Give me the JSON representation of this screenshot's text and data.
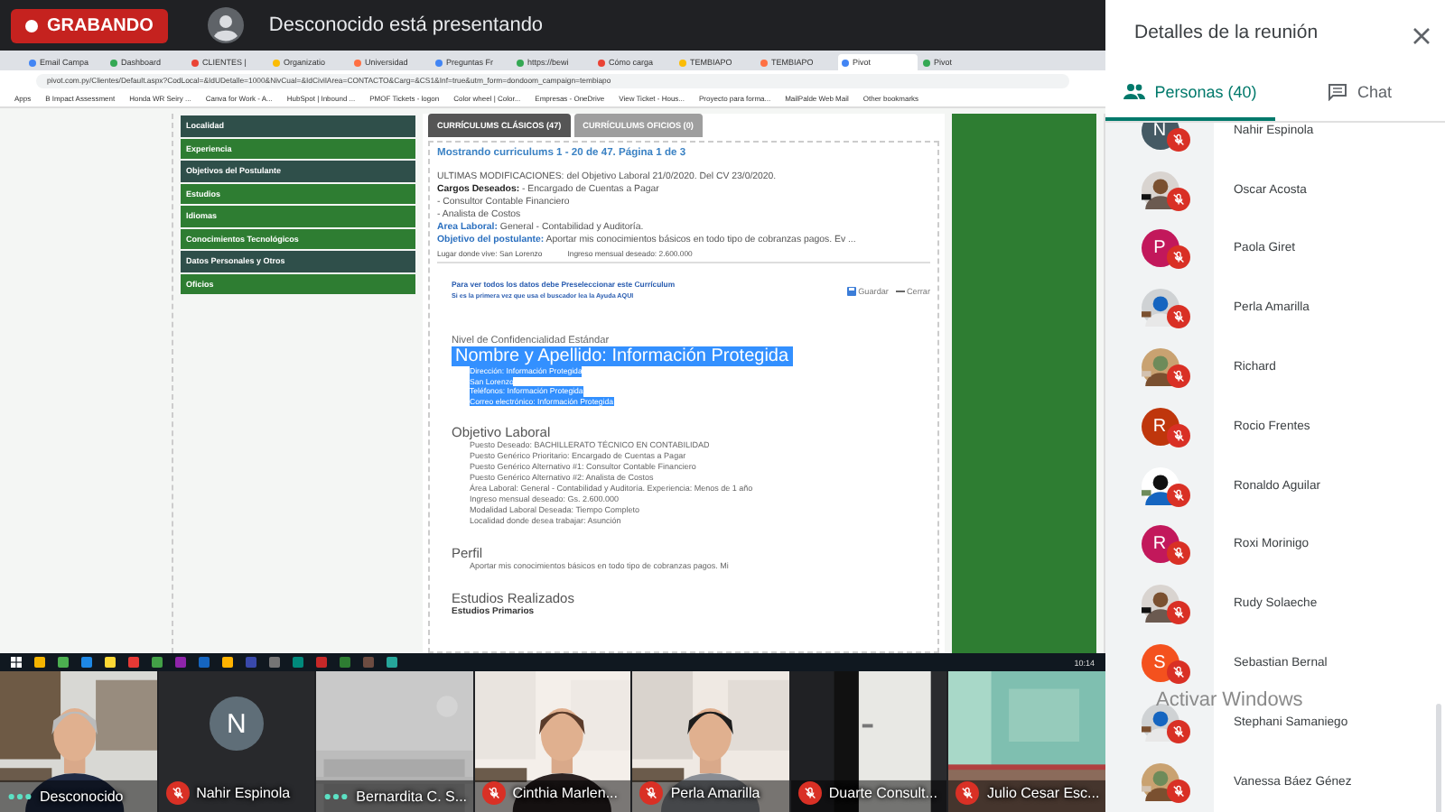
{
  "recording": {
    "label": "GRABANDO"
  },
  "presenter": {
    "text": "Desconocido está presentando"
  },
  "browser": {
    "tabs": [
      {
        "title": "Email Campa",
        "selected": false
      },
      {
        "title": "Dashboard",
        "selected": false
      },
      {
        "title": "CLIENTES |",
        "selected": false
      },
      {
        "title": "Organizatio",
        "selected": false
      },
      {
        "title": "Universidad",
        "selected": false
      },
      {
        "title": "Preguntas Fr",
        "selected": false
      },
      {
        "title": "https://bewi",
        "selected": false
      },
      {
        "title": "Cómo carga",
        "selected": false
      },
      {
        "title": "TEMBIAPO",
        "selected": false
      },
      {
        "title": "TEMBIAPO",
        "selected": false
      },
      {
        "title": "Pivot",
        "selected": true
      },
      {
        "title": "Pivot",
        "selected": false
      }
    ],
    "address": "pivot.com.py/Clientes/Default.aspx?CodLocal=&IdUDetalle=1000&NivCual=&IdCivilArea=CONTACTO&Carg=&CS1&Inf=true&utm_form=dondoom_campaign=tembiapo",
    "bookmarks": [
      "Apps",
      "B Impact Assessment",
      "Honda WR Seiry ...",
      "Canva for Work - A...",
      "HubSpot | Inbound ...",
      "PMOF Tickets - logon",
      "Color wheel | Color...",
      "Empresas - OneDrive",
      "View Ticket - Hous...",
      "Proyecto para forma...",
      "MailPalde Web Mail",
      "Other bookmarks"
    ]
  },
  "page": {
    "menu": [
      {
        "label": "Localidad",
        "color": "#2f4f4a"
      },
      {
        "label": "Experiencia",
        "color": "#2e7d32"
      },
      {
        "label": "Objetivos del Postulante",
        "color": "#2f4f4a"
      },
      {
        "label": "Estudios",
        "color": "#2e7d32"
      },
      {
        "label": "Idiomas",
        "color": "#2e7d32"
      },
      {
        "label": "Conocimientos Tecnológicos",
        "color": "#2e7d32"
      },
      {
        "label": "Datos Personales y Otros",
        "color": "#2f4f4a"
      },
      {
        "label": "Oficios",
        "color": "#2e7d32"
      }
    ],
    "tabs": [
      {
        "label": "CURRÍCULUMS CLÁSICOS (47)",
        "selected": true
      },
      {
        "label": "CURRÍCULUMS OFICIOS (0)",
        "selected": false
      }
    ],
    "heading": "Mostrando curriculums 1 - 20 de 47. Página 1 de 3",
    "summary": [
      {
        "kind": "plain",
        "label": "ULTIMAS MODIFICACIONES:",
        "value": "del Objetivo Laboral 21/0/2020. Del CV 23/0/2020."
      },
      {
        "kind": "dark",
        "label": "Cargos Deseados:",
        "value": "- Encargado de Cuentas a Pagar"
      },
      {
        "kind": "none",
        "value": "- Consultor Contable Financiero"
      },
      {
        "kind": "none",
        "value": "- Analista de Costos"
      },
      {
        "kind": "blue",
        "label": "Area Laboral:",
        "value": "General - Contabilidad y Auditoría."
      },
      {
        "kind": "blue",
        "label": "Objetivo del postulante:",
        "value": "Aportar mis conocimientos básicos en todo tipo de cobranzas pagos. Ev ..."
      }
    ],
    "summary_footer": [
      {
        "label": "Lugar donde vive:",
        "value": "San Lorenzo"
      },
      {
        "label": "Ingreso mensual deseado:",
        "value": "2.600.000"
      }
    ],
    "notice": [
      "Para ver todos los datos debe Preseleccionar este Currículum",
      "Si es la primera vez que usa el buscador lea la Ayuda AQUI"
    ],
    "actions": [
      {
        "kind": "save",
        "label": "Guardar"
      },
      {
        "kind": "close",
        "label": "Cerrar"
      }
    ],
    "confidentiality": "Nivel de Confidencialidad Estándar",
    "identity": {
      "highlighted": true,
      "name": "Nombre y Apellido: Información Protegida",
      "lines": [
        "Dirección: Información Protegida",
        "San Lorenzo",
        "Teléfonos: Información Protegida",
        "Correo electrónico: Información Protegida"
      ]
    },
    "sections": [
      {
        "title": "Objetivo Laboral",
        "lines": [
          "Puesto Deseado: BACHILLERATO TÉCNICO EN CONTABILIDAD",
          "Puesto Genérico Prioritario: Encargado de Cuentas a Pagar",
          "Puesto Genérico Alternativo #1: Consultor Contable Financiero",
          "Puesto Genérico Alternativo #2: Analista de Costos",
          "Área Laboral: General - Contabilidad y Auditoría. Experiencia: Menos de 1 año",
          "Ingreso mensual deseado: Gs. 2.600.000",
          "Modalidad Laboral Deseada: Tiempo Completo",
          "Localidad donde desea trabajar: Asunción"
        ]
      },
      {
        "title": "Perfil",
        "lines": [
          "Aportar mis conocimientos básicos en todo tipo de cobranzas pagos. Mi"
        ]
      },
      {
        "title": "Estudios Realizados",
        "subtitle": "Estudios Primarios"
      }
    ]
  },
  "taskbar": {
    "clock": "10:14"
  },
  "tiles": [
    {
      "kind": "picture",
      "name": "Desconocido",
      "muted": false
    },
    {
      "kind": "avatar",
      "initial": "N",
      "name": "Nahir Espinola",
      "muted": true
    },
    {
      "kind": "picture",
      "name": "Bernardita C. S...",
      "muted": false
    },
    {
      "kind": "picture",
      "name": "Cinthia Marlen...",
      "muted": true
    },
    {
      "kind": "picture",
      "name": "Perla Amarilla",
      "muted": true
    },
    {
      "kind": "picture",
      "name": "Duarte Consult...",
      "muted": true
    },
    {
      "kind": "picture",
      "name": "Julio Cesar Esc...",
      "muted": true
    }
  ],
  "panel": {
    "title": "Detalles de la reunión",
    "tabs": [
      {
        "kind": "people",
        "label": "Personas (40)",
        "selected": true
      },
      {
        "kind": "chat",
        "label": "Chat",
        "selected": false
      }
    ],
    "participants": [
      {
        "kind": "letter",
        "initial": "N",
        "color": "#455a64",
        "name": "Nahir Espinola",
        "muted": true
      },
      {
        "kind": "picture",
        "name": "Oscar Acosta",
        "muted": true
      },
      {
        "kind": "letter",
        "initial": "P",
        "color": "#c2185b",
        "name": "Paola Giret",
        "muted": true
      },
      {
        "kind": "picture",
        "name": "Perla Amarilla",
        "muted": true
      },
      {
        "kind": "picture",
        "name": "Richard",
        "muted": true
      },
      {
        "kind": "letter",
        "initial": "R",
        "color": "#bf360c",
        "name": "Rocio Frentes",
        "muted": true
      },
      {
        "kind": "picture",
        "name": "Ronaldo Aguilar",
        "muted": true
      },
      {
        "kind": "letter",
        "initial": "R",
        "color": "#c2185b",
        "name": "Roxi Morinigo",
        "muted": true
      },
      {
        "kind": "picture",
        "name": "Rudy Solaeche",
        "muted": true
      },
      {
        "kind": "letter",
        "initial": "S",
        "color": "#f4511e",
        "name": "Sebastian Bernal",
        "muted": true
      },
      {
        "kind": "picture",
        "name": "Stephani Samaniego",
        "muted": true
      },
      {
        "kind": "picture",
        "name": "Vanessa Báez Génez",
        "muted": true
      }
    ]
  },
  "os_notice": "Activar Windows"
}
